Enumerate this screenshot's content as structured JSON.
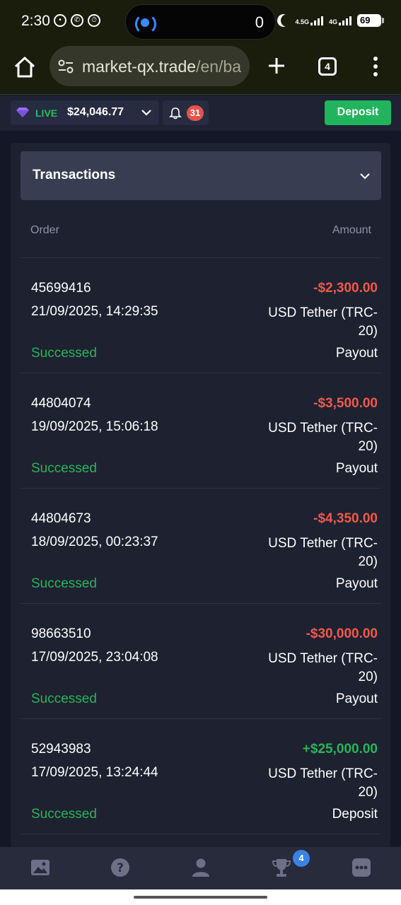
{
  "status_bar": {
    "time": "2:30",
    "island_count": "0",
    "network_type_1": "4.5G",
    "network_type_2": "4G",
    "battery": "69"
  },
  "browser": {
    "url_main": "market-qx.trade",
    "url_path": "/en/ba",
    "tab_count": "4"
  },
  "header": {
    "account_type": "LIVE",
    "balance": "$24,046.77",
    "notifications_count": "31",
    "deposit_label": "Deposit"
  },
  "transactions": {
    "title": "Transactions",
    "col_order": "Order",
    "col_amount": "Amount",
    "rows": [
      {
        "id": "45699416",
        "datetime": "21/09/2025, 14:29:35",
        "status": "Successed",
        "amount": "-$2,300.00",
        "method": "USD Tether (TRC-20)",
        "type": "Payout"
      },
      {
        "id": "44804074",
        "datetime": "19/09/2025, 15:06:18",
        "status": "Successed",
        "amount": "-$3,500.00",
        "method": "USD Tether (TRC-20)",
        "type": "Payout"
      },
      {
        "id": "44804673",
        "datetime": "18/09/2025, 00:23:37",
        "status": "Successed",
        "amount": "-$4,350.00",
        "method": "USD Tether (TRC-20)",
        "type": "Payout"
      },
      {
        "id": "98663510",
        "datetime": "17/09/2025, 23:04:08",
        "status": "Successed",
        "amount": "-$30,000.00",
        "method": "USD Tether (TRC-20)",
        "type": "Payout"
      },
      {
        "id": "52943983",
        "datetime": "17/09/2025, 13:24:44",
        "status": "Successed",
        "amount": "+$25,000.00",
        "method": "USD Tether (TRC-20)",
        "type": "Deposit"
      }
    ]
  },
  "bottom_nav": {
    "items": [
      "image-icon",
      "help-icon",
      "user-icon",
      "trophy-icon",
      "chat-icon"
    ],
    "trophy_badge": "4"
  },
  "colors": {
    "accent_green": "#20b45c",
    "negative_red": "#ef5a4a",
    "badge_red": "#e4534e",
    "badge_blue": "#3b82e6",
    "live_purple": "#9b6cff"
  }
}
